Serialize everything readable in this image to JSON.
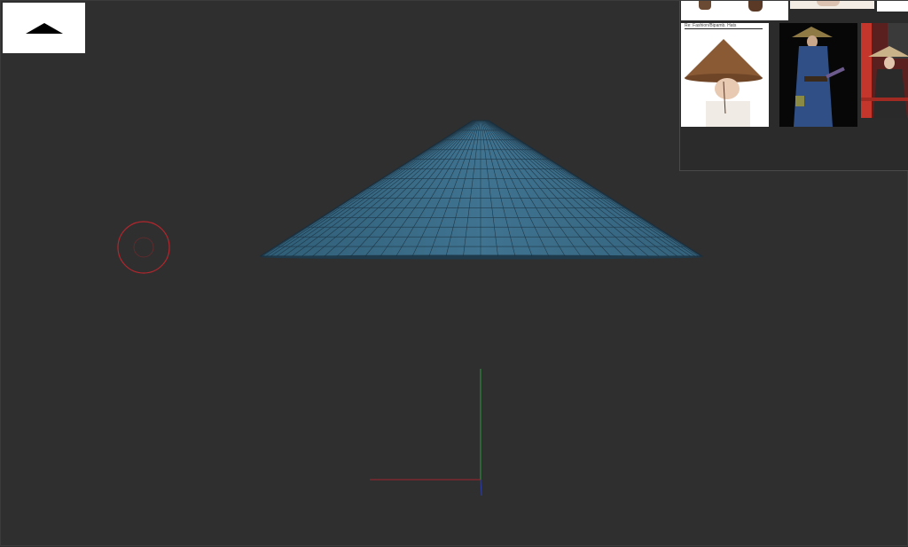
{
  "viewport": {
    "background": "#2f2f2f",
    "mesh_color": "#3b6b86",
    "wire_color": "#1b2f3d",
    "brush_cursor_color": "#b3262d",
    "axis_colors": {
      "x": "#a3262f",
      "y": "#2e9a3c",
      "z": "#2e3fa6"
    }
  },
  "toolbar": {
    "primitive_icon": "cone-primitive-icon"
  },
  "reference_panel": {
    "images": [
      {
        "name": "ref-hat-product"
      },
      {
        "name": "ref-samurai-blue-robe"
      },
      {
        "name": "ref-woman-straw-hat"
      }
    ],
    "caption": "Re: Fashion/Bipamb. Hats"
  }
}
